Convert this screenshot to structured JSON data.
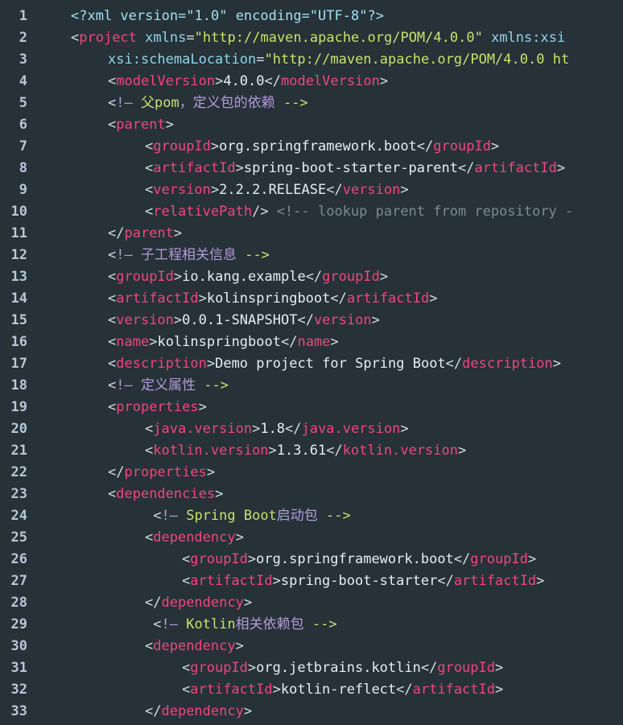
{
  "editor": {
    "lines": [
      {
        "n": "1",
        "indent": 0,
        "tokens": [
          [
            "t-pi",
            "<?xml version=\"1.0\" encoding=\"UTF-8\"?>"
          ]
        ]
      },
      {
        "n": "2",
        "indent": 0,
        "tokens": [
          [
            "t-punc",
            "<"
          ],
          [
            "t-tag",
            "project"
          ],
          [
            "t-punc",
            " "
          ],
          [
            "t-attr",
            "xmlns"
          ],
          [
            "t-punc",
            "="
          ],
          [
            "t-str",
            "\"http://maven.apache.org/POM/4.0.0\""
          ],
          [
            "t-punc",
            " "
          ],
          [
            "t-attr",
            "xmlns:xsi"
          ]
        ]
      },
      {
        "n": "3",
        "indent": 1,
        "tokens": [
          [
            "t-attr",
            "xsi:schemaLocation"
          ],
          [
            "t-punc",
            "="
          ],
          [
            "t-str",
            "\"http://maven.apache.org/POM/4.0.0 ht"
          ]
        ]
      },
      {
        "n": "4",
        "indent": 1,
        "tokens": [
          [
            "t-punc",
            "<"
          ],
          [
            "t-tag",
            "modelVersion"
          ],
          [
            "t-punc",
            ">"
          ],
          [
            "t-text",
            "4.0.0"
          ],
          [
            "t-punc",
            "</"
          ],
          [
            "t-tag",
            "modelVersion"
          ],
          [
            "t-punc",
            ">"
          ]
        ]
      },
      {
        "n": "5",
        "indent": 1,
        "tokens": [
          [
            "t-punc",
            "<"
          ],
          [
            "t-com",
            "!— "
          ],
          [
            "t-comh",
            "父pom"
          ],
          [
            "t-com",
            "，定义包的依赖 "
          ],
          [
            "t-comh",
            "-->"
          ]
        ]
      },
      {
        "n": "6",
        "indent": 1,
        "tokens": [
          [
            "t-punc",
            "<"
          ],
          [
            "t-tag",
            "parent"
          ],
          [
            "t-punc",
            ">"
          ]
        ]
      },
      {
        "n": "7",
        "indent": 2,
        "tokens": [
          [
            "t-punc",
            "<"
          ],
          [
            "t-tag",
            "groupId"
          ],
          [
            "t-punc",
            ">"
          ],
          [
            "t-text",
            "org.springframework.boot"
          ],
          [
            "t-punc",
            "</"
          ],
          [
            "t-tag",
            "groupId"
          ],
          [
            "t-punc",
            ">"
          ]
        ]
      },
      {
        "n": "8",
        "indent": 2,
        "tokens": [
          [
            "t-punc",
            "<"
          ],
          [
            "t-tag",
            "artifactId"
          ],
          [
            "t-punc",
            ">"
          ],
          [
            "t-text",
            "spring-boot-starter-parent"
          ],
          [
            "t-punc",
            "</"
          ],
          [
            "t-tag",
            "artifactId"
          ],
          [
            "t-punc",
            ">"
          ]
        ]
      },
      {
        "n": "9",
        "indent": 2,
        "tokens": [
          [
            "t-punc",
            "<"
          ],
          [
            "t-tag",
            "version"
          ],
          [
            "t-punc",
            ">"
          ],
          [
            "t-text",
            "2.2.2.RELEASE"
          ],
          [
            "t-punc",
            "</"
          ],
          [
            "t-tag",
            "version"
          ],
          [
            "t-punc",
            ">"
          ]
        ]
      },
      {
        "n": "10",
        "indent": 2,
        "tokens": [
          [
            "t-punc",
            "<"
          ],
          [
            "t-tag",
            "relativePath"
          ],
          [
            "t-punc",
            "/> "
          ],
          [
            "t-dim",
            "<!-- lookup parent from repository -"
          ]
        ]
      },
      {
        "n": "11",
        "indent": 1,
        "tokens": [
          [
            "t-punc",
            "</"
          ],
          [
            "t-tag",
            "parent"
          ],
          [
            "t-punc",
            ">"
          ]
        ]
      },
      {
        "n": "12",
        "indent": 1,
        "tokens": [
          [
            "t-punc",
            "<"
          ],
          [
            "t-com",
            "!— 子工程相关信息 "
          ],
          [
            "t-comh",
            "-->"
          ]
        ]
      },
      {
        "n": "13",
        "indent": 1,
        "tokens": [
          [
            "t-punc",
            "<"
          ],
          [
            "t-tag",
            "groupId"
          ],
          [
            "t-punc",
            ">"
          ],
          [
            "t-text",
            "io.kang.example"
          ],
          [
            "t-punc",
            "</"
          ],
          [
            "t-tag",
            "groupId"
          ],
          [
            "t-punc",
            ">"
          ]
        ]
      },
      {
        "n": "14",
        "indent": 1,
        "tokens": [
          [
            "t-punc",
            "<"
          ],
          [
            "t-tag",
            "artifactId"
          ],
          [
            "t-punc",
            ">"
          ],
          [
            "t-text",
            "kolinspringboot"
          ],
          [
            "t-punc",
            "</"
          ],
          [
            "t-tag",
            "artifactId"
          ],
          [
            "t-punc",
            ">"
          ]
        ]
      },
      {
        "n": "15",
        "indent": 1,
        "tokens": [
          [
            "t-punc",
            "<"
          ],
          [
            "t-tag",
            "version"
          ],
          [
            "t-punc",
            ">"
          ],
          [
            "t-text",
            "0.0.1-SNAPSHOT"
          ],
          [
            "t-punc",
            "</"
          ],
          [
            "t-tag",
            "version"
          ],
          [
            "t-punc",
            ">"
          ]
        ]
      },
      {
        "n": "16",
        "indent": 1,
        "tokens": [
          [
            "t-punc",
            "<"
          ],
          [
            "t-tag",
            "name"
          ],
          [
            "t-punc",
            ">"
          ],
          [
            "t-text",
            "kolinspringboot"
          ],
          [
            "t-punc",
            "</"
          ],
          [
            "t-tag",
            "name"
          ],
          [
            "t-punc",
            ">"
          ]
        ]
      },
      {
        "n": "17",
        "indent": 1,
        "tokens": [
          [
            "t-punc",
            "<"
          ],
          [
            "t-tag",
            "description"
          ],
          [
            "t-punc",
            ">"
          ],
          [
            "t-text",
            "Demo project for Spring Boot"
          ],
          [
            "t-punc",
            "</"
          ],
          [
            "t-tag",
            "description"
          ],
          [
            "t-punc",
            ">"
          ]
        ]
      },
      {
        "n": "18",
        "indent": 1,
        "tokens": [
          [
            "t-punc",
            "<"
          ],
          [
            "t-com",
            "!— 定义属性 "
          ],
          [
            "t-comh",
            "-->"
          ]
        ]
      },
      {
        "n": "19",
        "indent": 1,
        "tokens": [
          [
            "t-punc",
            "<"
          ],
          [
            "t-tag",
            "properties"
          ],
          [
            "t-punc",
            ">"
          ]
        ]
      },
      {
        "n": "20",
        "indent": 2,
        "tokens": [
          [
            "t-punc",
            "<"
          ],
          [
            "t-tag",
            "java.version"
          ],
          [
            "t-punc",
            ">"
          ],
          [
            "t-text",
            "1.8"
          ],
          [
            "t-punc",
            "</"
          ],
          [
            "t-tag",
            "java.version"
          ],
          [
            "t-punc",
            ">"
          ]
        ]
      },
      {
        "n": "21",
        "indent": 2,
        "tokens": [
          [
            "t-punc",
            "<"
          ],
          [
            "t-tag",
            "kotlin.version"
          ],
          [
            "t-punc",
            ">"
          ],
          [
            "t-text",
            "1.3.61"
          ],
          [
            "t-punc",
            "</"
          ],
          [
            "t-tag",
            "kotlin.version"
          ],
          [
            "t-punc",
            ">"
          ]
        ]
      },
      {
        "n": "22",
        "indent": 1,
        "tokens": [
          [
            "t-punc",
            "</"
          ],
          [
            "t-tag",
            "properties"
          ],
          [
            "t-punc",
            ">"
          ]
        ]
      },
      {
        "n": "23",
        "indent": 1,
        "tokens": [
          [
            "t-punc",
            "<"
          ],
          [
            "t-tag",
            "dependencies"
          ],
          [
            "t-punc",
            ">"
          ]
        ]
      },
      {
        "n": "24",
        "indent": 2,
        "tokens": [
          [
            "t-punc",
            " <"
          ],
          [
            "t-com",
            "!— "
          ],
          [
            "t-comh",
            "Spring Boot"
          ],
          [
            "t-com",
            "启动包 "
          ],
          [
            "t-comh",
            "-->"
          ]
        ]
      },
      {
        "n": "25",
        "indent": 2,
        "tokens": [
          [
            "t-punc",
            "<"
          ],
          [
            "t-tag",
            "dependency"
          ],
          [
            "t-punc",
            ">"
          ]
        ]
      },
      {
        "n": "26",
        "indent": 3,
        "tokens": [
          [
            "t-punc",
            "<"
          ],
          [
            "t-tag",
            "groupId"
          ],
          [
            "t-punc",
            ">"
          ],
          [
            "t-text",
            "org.springframework.boot"
          ],
          [
            "t-punc",
            "</"
          ],
          [
            "t-tag",
            "groupId"
          ],
          [
            "t-punc",
            ">"
          ]
        ]
      },
      {
        "n": "27",
        "indent": 3,
        "tokens": [
          [
            "t-punc",
            "<"
          ],
          [
            "t-tag",
            "artifactId"
          ],
          [
            "t-punc",
            ">"
          ],
          [
            "t-text",
            "spring-boot-starter"
          ],
          [
            "t-punc",
            "</"
          ],
          [
            "t-tag",
            "artifactId"
          ],
          [
            "t-punc",
            ">"
          ]
        ]
      },
      {
        "n": "28",
        "indent": 2,
        "tokens": [
          [
            "t-punc",
            "</"
          ],
          [
            "t-tag",
            "dependency"
          ],
          [
            "t-punc",
            ">"
          ]
        ]
      },
      {
        "n": "29",
        "indent": 2,
        "tokens": [
          [
            "t-punc",
            " <"
          ],
          [
            "t-com",
            "!— "
          ],
          [
            "t-comh",
            "Kotlin"
          ],
          [
            "t-com",
            "相关依赖包 "
          ],
          [
            "t-comh",
            "-->"
          ]
        ]
      },
      {
        "n": "30",
        "indent": 2,
        "tokens": [
          [
            "t-punc",
            "<"
          ],
          [
            "t-tag",
            "dependency"
          ],
          [
            "t-punc",
            ">"
          ]
        ]
      },
      {
        "n": "31",
        "indent": 3,
        "tokens": [
          [
            "t-punc",
            "<"
          ],
          [
            "t-tag",
            "groupId"
          ],
          [
            "t-punc",
            ">"
          ],
          [
            "t-text",
            "org.jetbrains.kotlin"
          ],
          [
            "t-punc",
            "</"
          ],
          [
            "t-tag",
            "groupId"
          ],
          [
            "t-punc",
            ">"
          ]
        ]
      },
      {
        "n": "32",
        "indent": 3,
        "tokens": [
          [
            "t-punc",
            "<"
          ],
          [
            "t-tag",
            "artifactId"
          ],
          [
            "t-punc",
            ">"
          ],
          [
            "t-text",
            "kotlin-reflect"
          ],
          [
            "t-punc",
            "</"
          ],
          [
            "t-tag",
            "artifactId"
          ],
          [
            "t-punc",
            ">"
          ]
        ]
      },
      {
        "n": "33",
        "indent": 2,
        "tokens": [
          [
            "t-punc",
            "</"
          ],
          [
            "t-tag",
            "dependency"
          ],
          [
            "t-punc",
            ">"
          ]
        ]
      }
    ]
  }
}
